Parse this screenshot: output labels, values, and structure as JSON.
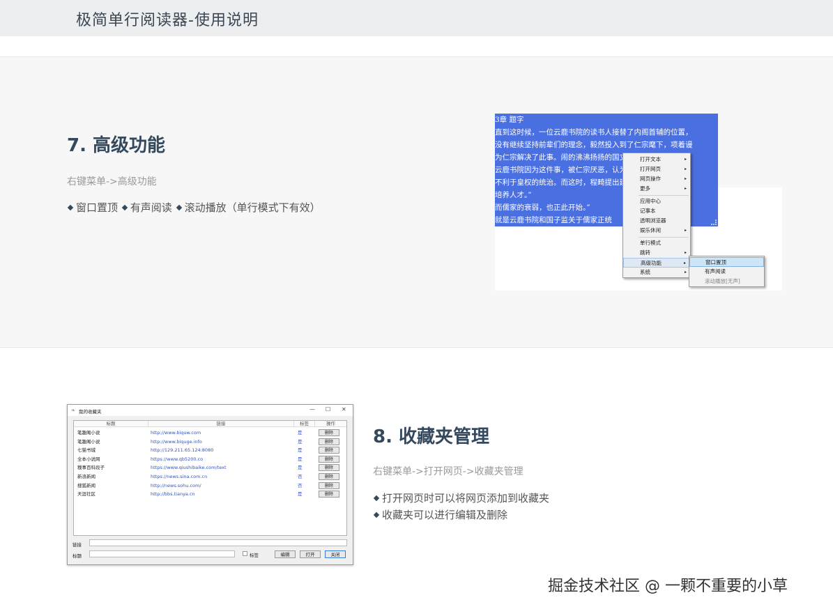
{
  "header": {
    "title": "极简单行阅读器-使用说明"
  },
  "section7": {
    "title": "7. 高级功能",
    "path": "右键菜单->高级功能",
    "features": [
      "窗口置顶",
      "有声阅读",
      "滚动播放（单行模式下有效）"
    ],
    "reader": {
      "lines": [
        "3章  题字",
        "直到这时候，一位云鹿书院的读书人接替了内阁首辅的位置，",
        "没有继续坚持前辈们的理念，毅然投入到了仁宗麾下，项着谩",
        "  为仁宗解决了此事。闹的沸沸扬扬的国丈一案才平息。",
        "云鹿书院因为这件事，被仁宗厌恶，认为儒家的存",
        "不利于皇权的统治。而这时，程畸提出建议，朝廷自",
        "培养人才。”",
        "而儒家的衰弱，也正此开始。”",
        "就是云鹿书院和国子监关于儒家正统"
      ]
    },
    "context_menu": {
      "items": [
        {
          "label": "打开文本",
          "arrow": "▸"
        },
        {
          "label": "打开网页",
          "arrow": "▸"
        },
        {
          "label": "网页操作",
          "arrow": "▸"
        },
        {
          "label": "更多",
          "arrow": "▸"
        },
        {
          "label": "应用中心",
          "arrow": ""
        },
        {
          "label": "记事本",
          "arrow": ""
        },
        {
          "label": "透明浏览器",
          "arrow": ""
        },
        {
          "label": "娱乐休闲",
          "arrow": "▸"
        },
        {
          "label": "单行模式",
          "arrow": ""
        },
        {
          "label": "跳转",
          "arrow": "▸"
        },
        {
          "label": "高级功能",
          "arrow": "▸"
        },
        {
          "label": "系统",
          "arrow": "▸"
        }
      ],
      "submenu": [
        "窗口置顶",
        "有声阅读",
        "滚动播放[无声]"
      ]
    }
  },
  "section8": {
    "title": "8. 收藏夹管理",
    "path": "右键菜单->打开网页->收藏夹管理",
    "features": [
      "打开网页时可以将网页添加到收藏夹",
      "收藏夹可以进行编辑及删除"
    ],
    "dialog": {
      "title": "我的收藏夹",
      "controls": [
        "—",
        "☐",
        "✕"
      ],
      "columns": [
        "标题",
        "链接",
        "标签",
        "操作"
      ],
      "rows": [
        {
          "title": "笔趣阁小说",
          "url": "http://www.biquw.com",
          "tag": "是",
          "action": "删除"
        },
        {
          "title": "笔趣阁小说",
          "url": "http://www.biquge.info",
          "tag": "是",
          "action": "删除"
        },
        {
          "title": "七猫书城",
          "url": "http://129.211.65.124:8080",
          "tag": "是",
          "action": "删除"
        },
        {
          "title": "全本小说网",
          "url": "https://www.qb5200.co",
          "tag": "是",
          "action": "删除"
        },
        {
          "title": "糗事百科段子",
          "url": "https://www.qiushibaike.com/text",
          "tag": "是",
          "action": "删除"
        },
        {
          "title": "新浪新闻",
          "url": "https://news.sina.com.cn",
          "tag": "否",
          "action": "删除"
        },
        {
          "title": "搜狐新闻",
          "url": "http://news.sohu.com/",
          "tag": "否",
          "action": "删除"
        },
        {
          "title": "天涯社区",
          "url": "http://bbs.tianya.cn",
          "tag": "是",
          "action": "删除"
        }
      ],
      "link_label": "链接",
      "title_label": "标题",
      "tag_label": "标签",
      "buttons": {
        "edit": "编辑",
        "open": "打开",
        "close": "关闭"
      }
    }
  },
  "watermark": "掘金技术社区 @ 一颗不重要的小草"
}
